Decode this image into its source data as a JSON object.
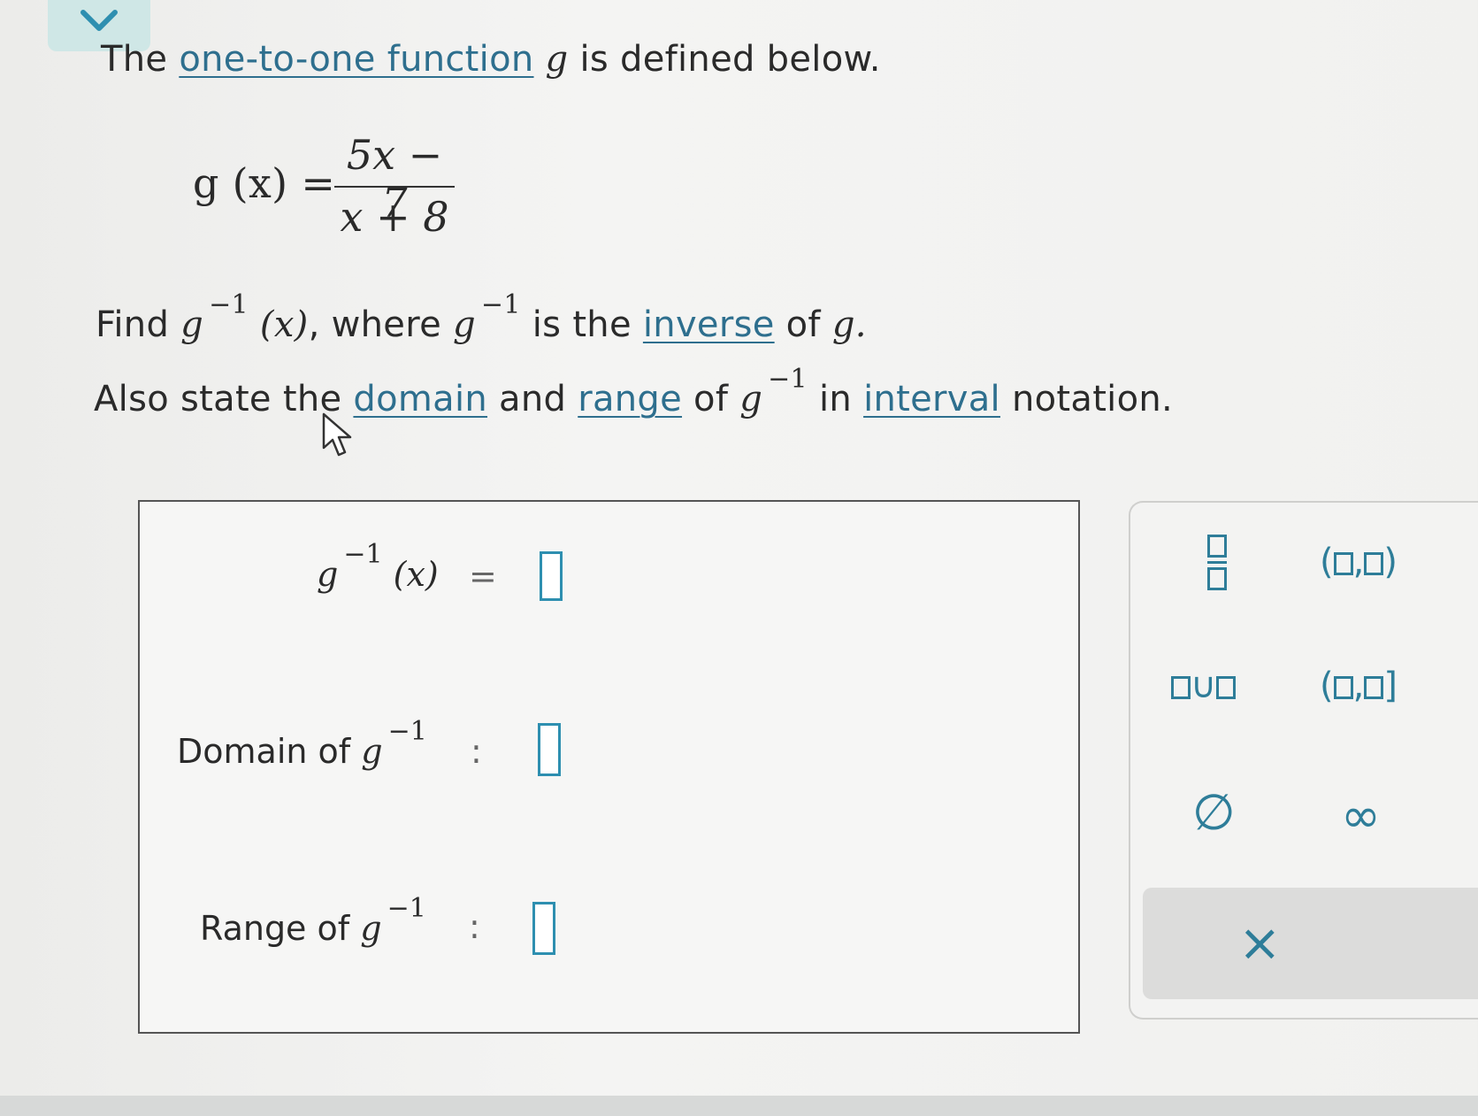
{
  "intro": {
    "prefix": "The",
    "link": "one-to-one function",
    "var": "g",
    "suffix": "is defined below."
  },
  "function_def": {
    "lhs": "g (x) =",
    "numerator": "5x − 7",
    "denominator": "x + 8"
  },
  "find_line": {
    "find": "Find",
    "g": "g",
    "exp": "−1",
    "arg": "(x)",
    "where": ", where",
    "is_the": "is the",
    "link": "inverse",
    "of": "of",
    "g_end": "g."
  },
  "also_line": {
    "prefix": "Also state the",
    "domain_link": "domain",
    "and": "and",
    "range_link": "range",
    "of": "of",
    "g": "g",
    "exp": "−1",
    "in": "in",
    "interval_link": "interval",
    "notation": "notation."
  },
  "answers": {
    "inverse": {
      "g": "g",
      "exp": "−1",
      "arg": "(x)",
      "eq": "="
    },
    "domain": {
      "label": "Domain of",
      "g": "g",
      "exp": "−1",
      "colon": ":"
    },
    "range": {
      "label": "Range of",
      "g": "g",
      "exp": "−1",
      "colon": ":"
    }
  },
  "keypad": {
    "fraction": "fraction",
    "open_interval_l": "(",
    "open_interval_comma": ",",
    "open_interval_r": ")",
    "union": "∪",
    "half_open_l": "(",
    "half_open_comma": ",",
    "half_open_r": "]",
    "empty_set": "∅",
    "infinity": "∞",
    "clear": "×"
  },
  "colors": {
    "link": "#2e6f8e",
    "accent": "#2e8fb0",
    "tab": "#cfe7e6"
  }
}
